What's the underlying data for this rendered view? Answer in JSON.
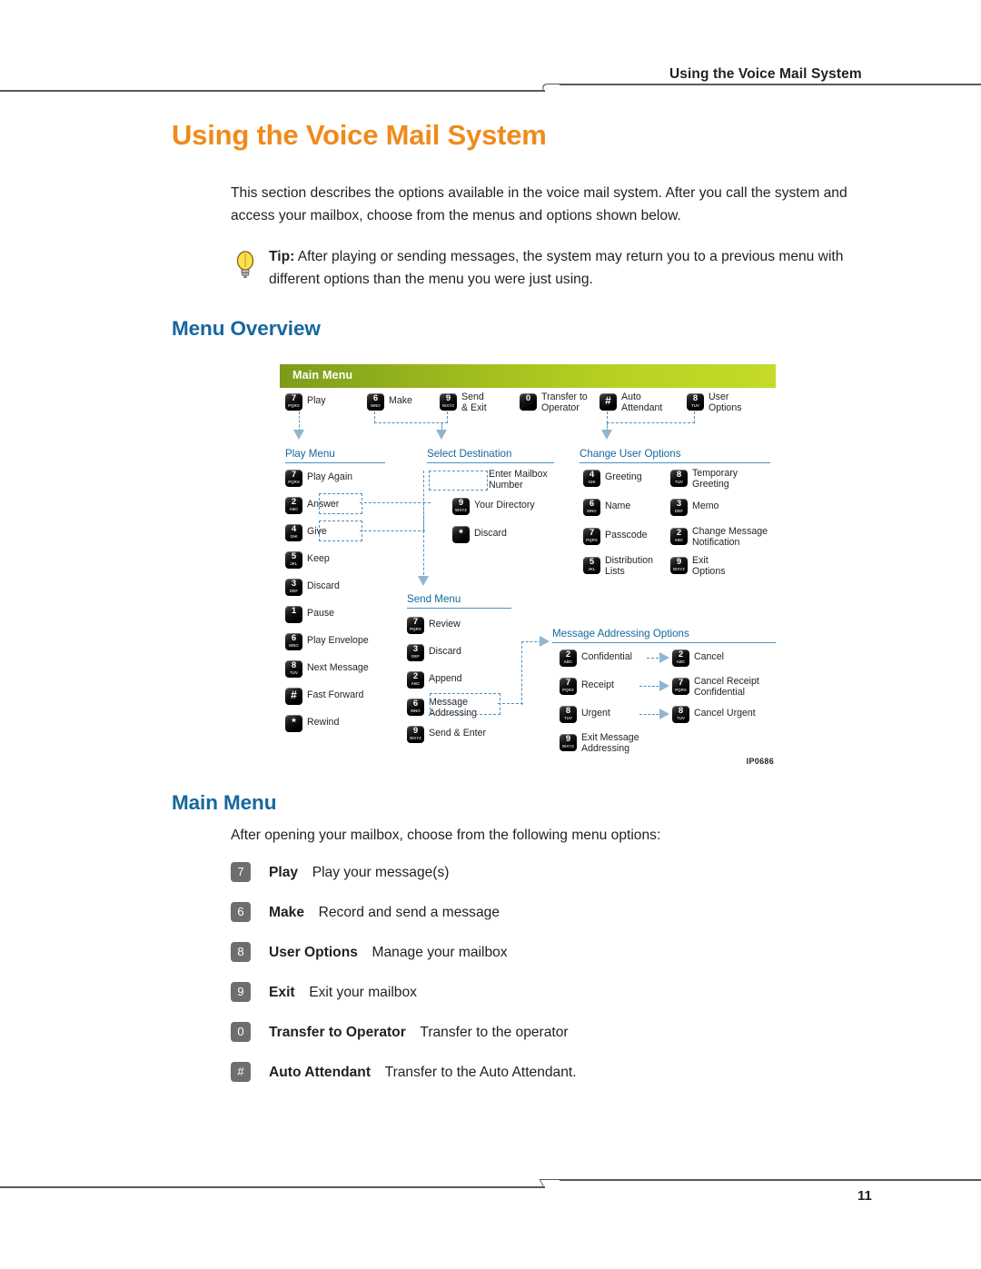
{
  "header": {
    "running_title": "Using the Voice Mail System"
  },
  "page_title": "Using the Voice Mail System",
  "intro": "This section describes the options available in the voice mail system. After you call the system and access your mailbox, choose from the menus and options shown below.",
  "tip": {
    "icon": "lightbulb-icon",
    "label": "Tip:",
    "text": " After playing or sending messages, the system may return you to a previous menu with different options than the menu you were just using."
  },
  "sections": {
    "menu_overview_heading": "Menu Overview",
    "main_menu_heading": "Main Menu",
    "main_menu_intro": "After opening your mailbox, choose from the following menu options:"
  },
  "diagram": {
    "banner_title": "Main Menu",
    "code": "IP0686",
    "main_row": [
      {
        "num": "7",
        "sub": "PQRS",
        "label": "Play"
      },
      {
        "num": "6",
        "sub": "MNO",
        "label": "Make"
      },
      {
        "num": "9",
        "sub": "WXYZ",
        "label": "Send\n& Exit"
      },
      {
        "num": "0",
        "sub": "",
        "label": "Transfer to\nOperator"
      },
      {
        "num": "#",
        "sub": "",
        "label": "Auto\nAttendant"
      },
      {
        "num": "8",
        "sub": "TUV",
        "label": "User\nOptions"
      }
    ],
    "play_menu": {
      "heading": "Play Menu",
      "items": [
        {
          "num": "7",
          "sub": "PQRS",
          "label": "Play Again"
        },
        {
          "num": "2",
          "sub": "ABC",
          "label": "Answer"
        },
        {
          "num": "4",
          "sub": "GHI",
          "label": "Give"
        },
        {
          "num": "5",
          "sub": "JKL",
          "label": "Keep"
        },
        {
          "num": "3",
          "sub": "DEF",
          "label": "Discard"
        },
        {
          "num": "1",
          "sub": "",
          "label": "Pause"
        },
        {
          "num": "6",
          "sub": "MNO",
          "label": "Play Envelope"
        },
        {
          "num": "8",
          "sub": "TUV",
          "label": "Next Message"
        },
        {
          "num": "#",
          "sub": "",
          "label": "Fast Forward"
        },
        {
          "num": "*",
          "sub": "",
          "label": "Rewind"
        }
      ]
    },
    "select_destination": {
      "heading": "Select Destination",
      "items": [
        {
          "num": "",
          "sub": "",
          "label": "Enter Mailbox\nNumber"
        },
        {
          "num": "9",
          "sub": "WXYZ",
          "label": "Your Directory"
        },
        {
          "num": "*",
          "sub": "",
          "label": "Discard"
        }
      ]
    },
    "send_menu": {
      "heading": "Send Menu",
      "items": [
        {
          "num": "7",
          "sub": "PQRS",
          "label": "Review"
        },
        {
          "num": "3",
          "sub": "DEF",
          "label": "Discard"
        },
        {
          "num": "2",
          "sub": "ABC",
          "label": "Append"
        },
        {
          "num": "6",
          "sub": "MNO",
          "label": "Message\nAddressing"
        },
        {
          "num": "9",
          "sub": "WXYZ",
          "label": "Send & Enter"
        }
      ]
    },
    "change_user_options": {
      "heading": "Change User Options",
      "col1": [
        {
          "num": "4",
          "sub": "GHI",
          "label": "Greeting"
        },
        {
          "num": "6",
          "sub": "MNO",
          "label": "Name"
        },
        {
          "num": "7",
          "sub": "PQRS",
          "label": "Passcode"
        },
        {
          "num": "5",
          "sub": "JKL",
          "label": "Distribution\nLists"
        }
      ],
      "col2": [
        {
          "num": "8",
          "sub": "TUV",
          "label": "Temporary\nGreeting"
        },
        {
          "num": "3",
          "sub": "DEF",
          "label": "Memo"
        },
        {
          "num": "2",
          "sub": "ABC",
          "label": "Change Message\nNotification"
        },
        {
          "num": "9",
          "sub": "WXYZ",
          "label": "Exit\nOptions"
        }
      ]
    },
    "message_addressing": {
      "heading": "Message Addressing Options",
      "col1": [
        {
          "num": "2",
          "sub": "ABC",
          "label": "Confidential"
        },
        {
          "num": "7",
          "sub": "PQRS",
          "label": "Receipt"
        },
        {
          "num": "8",
          "sub": "TUV",
          "label": "Urgent"
        },
        {
          "num": "9",
          "sub": "WXYZ",
          "label": "Exit Message\nAddressing"
        }
      ],
      "col2": [
        {
          "num": "2",
          "sub": "ABC",
          "label": "Cancel"
        },
        {
          "num": "7",
          "sub": "PQRS",
          "label": "Cancel Receipt\nConfidential"
        },
        {
          "num": "8",
          "sub": "TUV",
          "label": "Cancel Urgent"
        }
      ]
    }
  },
  "main_menu_options": [
    {
      "key": "7",
      "label": "Play",
      "desc": "Play your message(s)"
    },
    {
      "key": "6",
      "label": "Make",
      "desc": "Record and send a message"
    },
    {
      "key": "8",
      "label": "User Options",
      "desc": "Manage your mailbox"
    },
    {
      "key": "9",
      "label": "Exit",
      "desc": "Exit your mailbox"
    },
    {
      "key": "0",
      "label": "Transfer to Operator",
      "desc": "Transfer to the operator"
    },
    {
      "key": "#",
      "label": "Auto Attendant",
      "desc": "Transfer to the Auto Attendant."
    }
  ],
  "footer": {
    "page_number": "11"
  },
  "colors": {
    "title_orange": "#F08A1C",
    "heading_blue": "#15679F",
    "connector_blue": "#4e90c0",
    "banner_green_dark": "#7d9b1a",
    "banner_green_light": "#c5da2a",
    "gray_key": "#6d6e70"
  }
}
